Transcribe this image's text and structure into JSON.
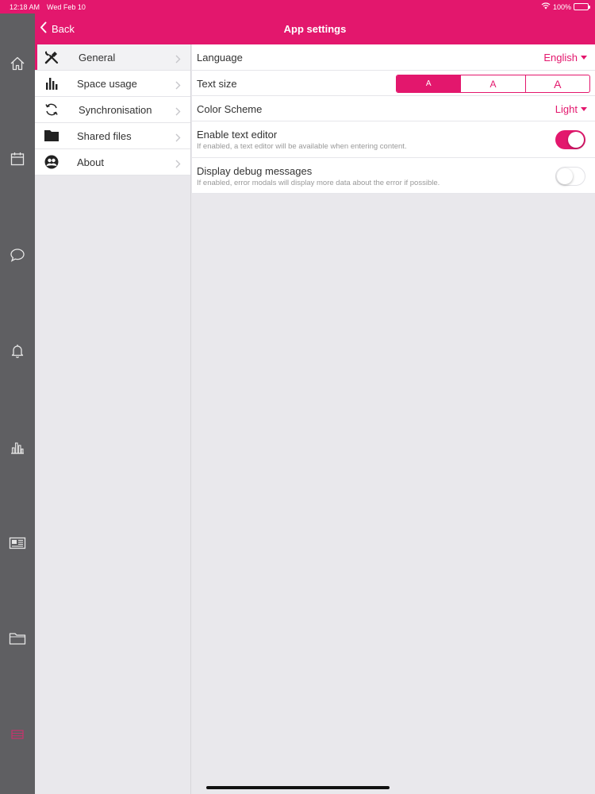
{
  "status_bar": {
    "time": "12:18 AM",
    "date": "Wed Feb 10",
    "battery": "100%",
    "battery_level": 1.0
  },
  "header": {
    "back_label": "Back",
    "title": "App settings"
  },
  "rail": {
    "icons": [
      "home-icon",
      "calendar-icon",
      "chat-icon",
      "bell-icon",
      "chart-icon",
      "news-icon",
      "folder-icon",
      "settings-icon"
    ]
  },
  "menu": {
    "items": [
      {
        "label": "General",
        "icon": "tools-icon",
        "active": true
      },
      {
        "label": "Space usage",
        "icon": "bar-chart-icon",
        "active": false
      },
      {
        "label": "Synchronisation",
        "icon": "sync-icon",
        "active": false
      },
      {
        "label": "Shared files",
        "icon": "folder-icon",
        "active": false
      },
      {
        "label": "About",
        "icon": "users-icon",
        "active": false
      }
    ]
  },
  "settings": {
    "language": {
      "label": "Language",
      "value": "English"
    },
    "text_size": {
      "label": "Text size",
      "options": [
        "A",
        "A",
        "A"
      ],
      "selected_index": 0
    },
    "color_scheme": {
      "label": "Color Scheme",
      "value": "Light"
    },
    "text_editor": {
      "label": "Enable text editor",
      "description": "If enabled, a text editor will be available when entering content.",
      "enabled": true
    },
    "debug": {
      "label": "Display debug messages",
      "description": "If enabled, error modals will display more data about the error if possible.",
      "enabled": false
    }
  },
  "colors": {
    "accent": "#e3176d",
    "rail": "#5f5f62",
    "background": "#e9e8ec"
  }
}
